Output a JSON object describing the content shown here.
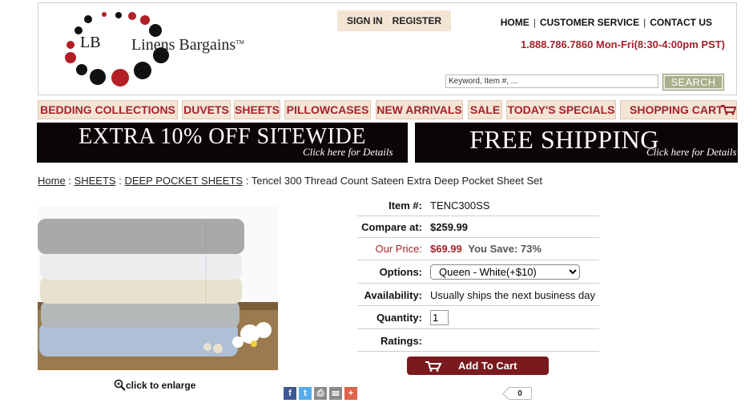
{
  "header": {
    "logo_text": "Linens Bargains",
    "logo_tm": "TM",
    "logo_initials": "LB",
    "signin_label": "SIGN IN",
    "register_label": "REGISTER",
    "toplinks": [
      "HOME",
      "CUSTOMER SERVICE",
      "CONTACT US"
    ],
    "phone": "1.888.786.7860 Mon-Fri(8:30-4:00pm PST)",
    "search_placeholder": "Keyword, Item #, ...",
    "search_button": "SEARCH"
  },
  "nav": {
    "items": [
      "BEDDING COLLECTIONS",
      "DUVETS",
      "SHEETS",
      "PILLOWCASES",
      "NEW ARRIVALS",
      "SALE",
      "TODAY'S SPECIALS",
      "SHOPPING CART"
    ]
  },
  "banners": {
    "left_main": "EXTRA 10% OFF SITEWIDE",
    "left_sub": "Click here for Details",
    "right_main": "FREE SHIPPING",
    "right_sub": "Click here for Details"
  },
  "breadcrumb": {
    "home": "Home",
    "sheets": "SHEETS",
    "deep": "DEEP POCKET SHEETS",
    "current": "Tencel 300 Thread Count Sateen Extra Deep Pocket Sheet Set",
    "sep": ":"
  },
  "product": {
    "enlarge_label": "click to enlarge",
    "item_label": "Item #:",
    "item_value": "TENC300SS",
    "compare_label": "Compare at:",
    "compare_value": "$259.99",
    "price_label": "Our Price:",
    "price_value": "$69.99",
    "save_value": "You Save: 73%",
    "options_label": "Options:",
    "options_selected": "Queen - White(+$10)",
    "availability_label": "Availability:",
    "availability_value": "Usually ships the next business day",
    "quantity_label": "Quantity:",
    "quantity_value": "1",
    "ratings_label": "Ratings:",
    "add_to_cart": "Add To Cart",
    "like_count": "0"
  },
  "colors": {
    "brand_red": "#a3232a",
    "nav_bg": "#f3e4d4",
    "cart_button": "#7a1a1e",
    "search_button": "#a7b08a"
  },
  "share_icons": [
    "facebook-icon",
    "twitter-icon",
    "print-icon",
    "email-icon",
    "more-icon"
  ]
}
